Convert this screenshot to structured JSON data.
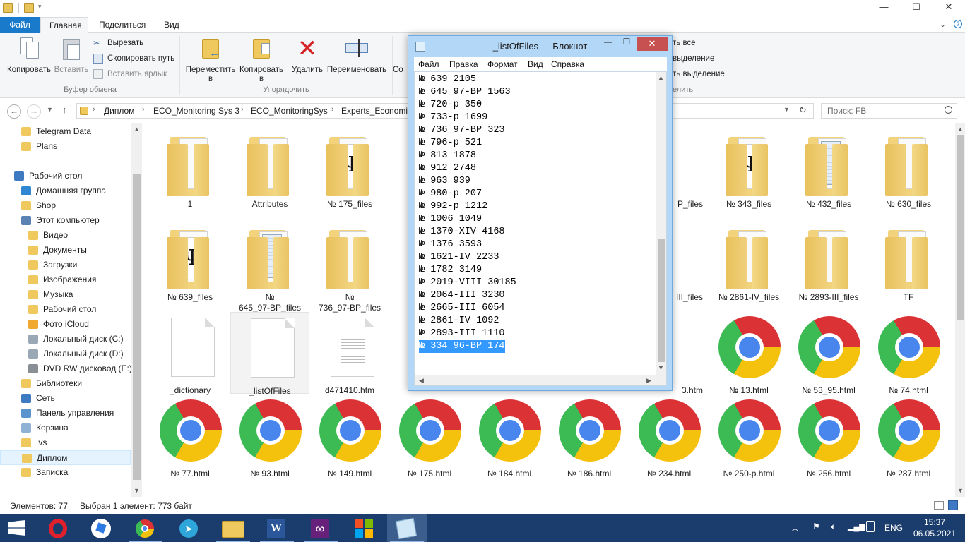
{
  "explorer": {
    "window_controls": {
      "minimize": "—",
      "maximize": "☐",
      "close": "✕"
    },
    "tabs": {
      "file": "Файл",
      "home": "Главная",
      "share": "Поделиться",
      "view": "Вид"
    },
    "ribbon": {
      "copy": "Копировать",
      "paste": "Вставить",
      "cut": "Вырезать",
      "copy_path": "Скопировать путь",
      "paste_shortcut": "Вставить ярлык",
      "clipboard_group": "Буфер обмена",
      "move_to": "Переместить",
      "move_to_2": "в",
      "copy_to": "Копировать",
      "copy_to_2": "в",
      "delete": "Удалить",
      "rename": "Переименовать",
      "organize_group": "Упорядочить",
      "new_partial": "Со",
      "select_all_partial": "ть все",
      "deselect_partial": "выделение",
      "invert_partial": "ть выделение",
      "select_group_partial": "елить"
    },
    "address": {
      "breadcrumbs": [
        "Диплом",
        "ECO_Monitoring Sys 3",
        "ECO_MonitoringSys",
        "Experts_Economis"
      ],
      "search_placeholder": "Поиск: FB"
    },
    "nav": [
      {
        "label": "Telegram Data",
        "icon": "folder-icon"
      },
      {
        "label": "Plans",
        "icon": "folder-icon"
      },
      {
        "label": "Рабочий стол",
        "icon": "desktop-icon"
      },
      {
        "label": "Домашняя группа",
        "icon": "homegroup-icon"
      },
      {
        "label": "Shop",
        "icon": "folder-icon"
      },
      {
        "label": "Этот компьютер",
        "icon": "computer-icon"
      },
      {
        "label": "Видео",
        "icon": "video-folder-icon"
      },
      {
        "label": "Документы",
        "icon": "documents-folder-icon"
      },
      {
        "label": "Загрузки",
        "icon": "downloads-folder-icon"
      },
      {
        "label": "Изображения",
        "icon": "pictures-folder-icon"
      },
      {
        "label": "Музыка",
        "icon": "music-folder-icon"
      },
      {
        "label": "Рабочий стол",
        "icon": "desktop-folder-icon"
      },
      {
        "label": "Фото iCloud",
        "icon": "icloud-photos-icon"
      },
      {
        "label": "Локальный диск (C:)",
        "icon": "drive-icon"
      },
      {
        "label": "Локальный диск (D:)",
        "icon": "drive-icon"
      },
      {
        "label": "DVD RW дисковод (E:)",
        "icon": "dvd-drive-icon"
      },
      {
        "label": "Библиотеки",
        "icon": "libraries-icon"
      },
      {
        "label": "Сеть",
        "icon": "network-icon"
      },
      {
        "label": "Панель управления",
        "icon": "control-panel-icon"
      },
      {
        "label": "Корзина",
        "icon": "recycle-bin-icon"
      },
      {
        "label": ".vs",
        "icon": "folder-icon"
      },
      {
        "label": "Диплом",
        "icon": "folder-icon"
      },
      {
        "label": "Записка",
        "icon": "folder-icon"
      }
    ],
    "files": {
      "row1": [
        {
          "name": "1",
          "kind": "folder"
        },
        {
          "name": "Attributes",
          "kind": "folder"
        },
        {
          "name": "№ 175_files",
          "kind": "folder-trident"
        },
        {
          "name": "",
          "kind": "hidden"
        },
        {
          "name": "",
          "kind": "hidden"
        },
        {
          "name": "",
          "kind": "hidden"
        },
        {
          "name": "P_files",
          "kind": "partial"
        },
        {
          "name": "№ 343_files",
          "kind": "folder-trident"
        },
        {
          "name": "№ 432_files",
          "kind": "folder-notebook"
        },
        {
          "name": "№ 630_files",
          "kind": "folder"
        }
      ],
      "row2": [
        {
          "name": "№ 639_files",
          "kind": "folder-trident"
        },
        {
          "name": "№",
          "name2": "645_97-BP_files",
          "kind": "folder-notebook"
        },
        {
          "name": "№",
          "name2": "736_97-BP_files",
          "kind": "folder"
        },
        {
          "name": "",
          "kind": "hidden"
        },
        {
          "name": "",
          "kind": "hidden"
        },
        {
          "name": "",
          "kind": "hidden"
        },
        {
          "name": "III_files",
          "kind": "partial"
        },
        {
          "name": "№ 2861-IV_files",
          "kind": "folder"
        },
        {
          "name": "№ 2893-III_files",
          "kind": "folder"
        },
        {
          "name": "TF",
          "kind": "folder"
        }
      ],
      "row3": [
        {
          "name": "_dictionary",
          "kind": "blank"
        },
        {
          "name": "_listOfFiles",
          "kind": "blank",
          "selected": true
        },
        {
          "name": "d471410.htm",
          "kind": "text"
        },
        {
          "name": "",
          "kind": "hidden"
        },
        {
          "name": "",
          "kind": "hidden"
        },
        {
          "name": "",
          "kind": "hidden"
        },
        {
          "name": "3.htm",
          "kind": "partial"
        },
        {
          "name": "№ 13.html",
          "kind": "chrome"
        },
        {
          "name": "№ 53_95.html",
          "kind": "chrome"
        },
        {
          "name": "№ 74.html",
          "kind": "chrome"
        }
      ],
      "row4": [
        {
          "name": "№ 77.html",
          "kind": "chrome"
        },
        {
          "name": "№ 93.html",
          "kind": "chrome"
        },
        {
          "name": "№ 149.html",
          "kind": "chrome"
        },
        {
          "name": "№ 175.html",
          "kind": "chrome"
        },
        {
          "name": "№ 184.html",
          "kind": "chrome"
        },
        {
          "name": "№ 186.html",
          "kind": "chrome"
        },
        {
          "name": "№ 234.html",
          "kind": "chrome"
        },
        {
          "name": "№ 250-p.html",
          "kind": "chrome"
        },
        {
          "name": "№ 256.html",
          "kind": "chrome"
        },
        {
          "name": "№ 287.html",
          "kind": "chrome"
        }
      ]
    },
    "status": {
      "count": "Элементов: 77",
      "selection": "Выбран 1 элемент: 773 байт"
    }
  },
  "notepad": {
    "title": "_listOfFiles — Блокнот",
    "menu": {
      "file": "Файл",
      "edit": "Правка",
      "format": "Формат",
      "view": "Вид",
      "help": "Справка"
    },
    "close": "✕",
    "lines": [
      "№ 639 2105",
      "№ 645_97-ВР 1563",
      "№ 720-р 350",
      "№ 733-р 1699",
      "№ 736_97-ВР 323",
      "№ 796-р 521",
      "№ 813 1878",
      "№ 912 2748",
      "№ 963 939",
      "№ 980-р 207",
      "№ 992-р 1212",
      "№ 1006 1049",
      "№ 1370-XIV 4168",
      "№ 1376 3593",
      "№ 1621-IV 2233",
      "№ 1782 3149",
      "№ 2019-VIII 30185",
      "№ 2064-III 3230",
      "№ 2665-III 6054",
      "№ 2861-IV 1092",
      "№ 2893-III 1110",
      "№ 334_96-ВР 174"
    ]
  },
  "taskbar": {
    "lang": "ENG",
    "time": "15:37",
    "date": "06.05.2021"
  }
}
